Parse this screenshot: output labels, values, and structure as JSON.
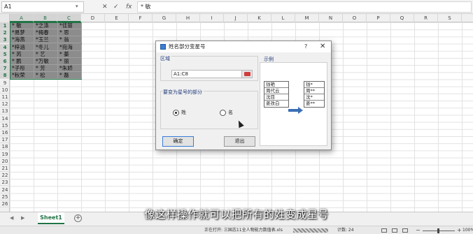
{
  "formula_bar": {
    "name_box": "A1",
    "cancel_glyph": "✕",
    "enter_glyph": "✓",
    "fx_label": "fx",
    "content": "* 敏"
  },
  "columns": [
    "A",
    "B",
    "C",
    "D",
    "E",
    "F",
    "G",
    "H",
    "I",
    "J",
    "K",
    "L",
    "M",
    "N",
    "O",
    "P",
    "Q",
    "R",
    "S"
  ],
  "rows": [
    "1",
    "2",
    "3",
    "4",
    "5",
    "6",
    "7",
    "8",
    "9",
    "10",
    "11",
    "12",
    "13",
    "14",
    "15",
    "16",
    "17",
    "18",
    "19",
    "20",
    "21",
    "22",
    "23",
    "24",
    "25",
    "26"
  ],
  "cells": [
    [
      "* 敏",
      "*之涤",
      "*佳丽"
    ],
    [
      "*易梦",
      "*梅春",
      "* 思"
    ],
    [
      "*海燕",
      "*玉兰",
      "* 翁"
    ],
    [
      "*梓涵",
      "*冬儿",
      "*宛海"
    ],
    [
      "* 芮",
      "* 艺",
      "* 蓁"
    ],
    [
      "* 鹏",
      "*万敏",
      "* 丽"
    ],
    [
      "*子彤",
      "* 芳",
      "*朱娇"
    ],
    [
      "*秋荣",
      "* 松",
      "* 磊"
    ]
  ],
  "dialog": {
    "title": "姓名部分变星号",
    "help": "?",
    "close": "✕",
    "range_group_label": "区域",
    "range_value": "A1:C8",
    "part_group_label": "要变为星号的部分",
    "option_surname": "姓",
    "option_given": "名",
    "example_label": "示例",
    "example_before": [
      "钱艳",
      "周代云",
      "沈目",
      "姜孜白"
    ],
    "example_after": [
      "钱*",
      "周**",
      "沈*",
      "姜**"
    ],
    "ok_label": "确定",
    "exit_label": "退出"
  },
  "subtitle": "像这样操作就可以把所有的姓变成星号",
  "sheet_tabs": {
    "nav_prev": "◀",
    "nav_next": "▶",
    "active": "Sheet1",
    "add": "+"
  },
  "status_bar": {
    "file_status": "正在打开: 三国志11全人物能力数值表.xls",
    "progress": 0.6,
    "count": "计数: 24",
    "zoom_minus": "−",
    "zoom_plus": "+",
    "zoom_level": "100%"
  },
  "colors": {
    "accent": "#217346",
    "selection_fill": "#8c8c8c",
    "dialog_bg": "#f0f0f0"
  }
}
